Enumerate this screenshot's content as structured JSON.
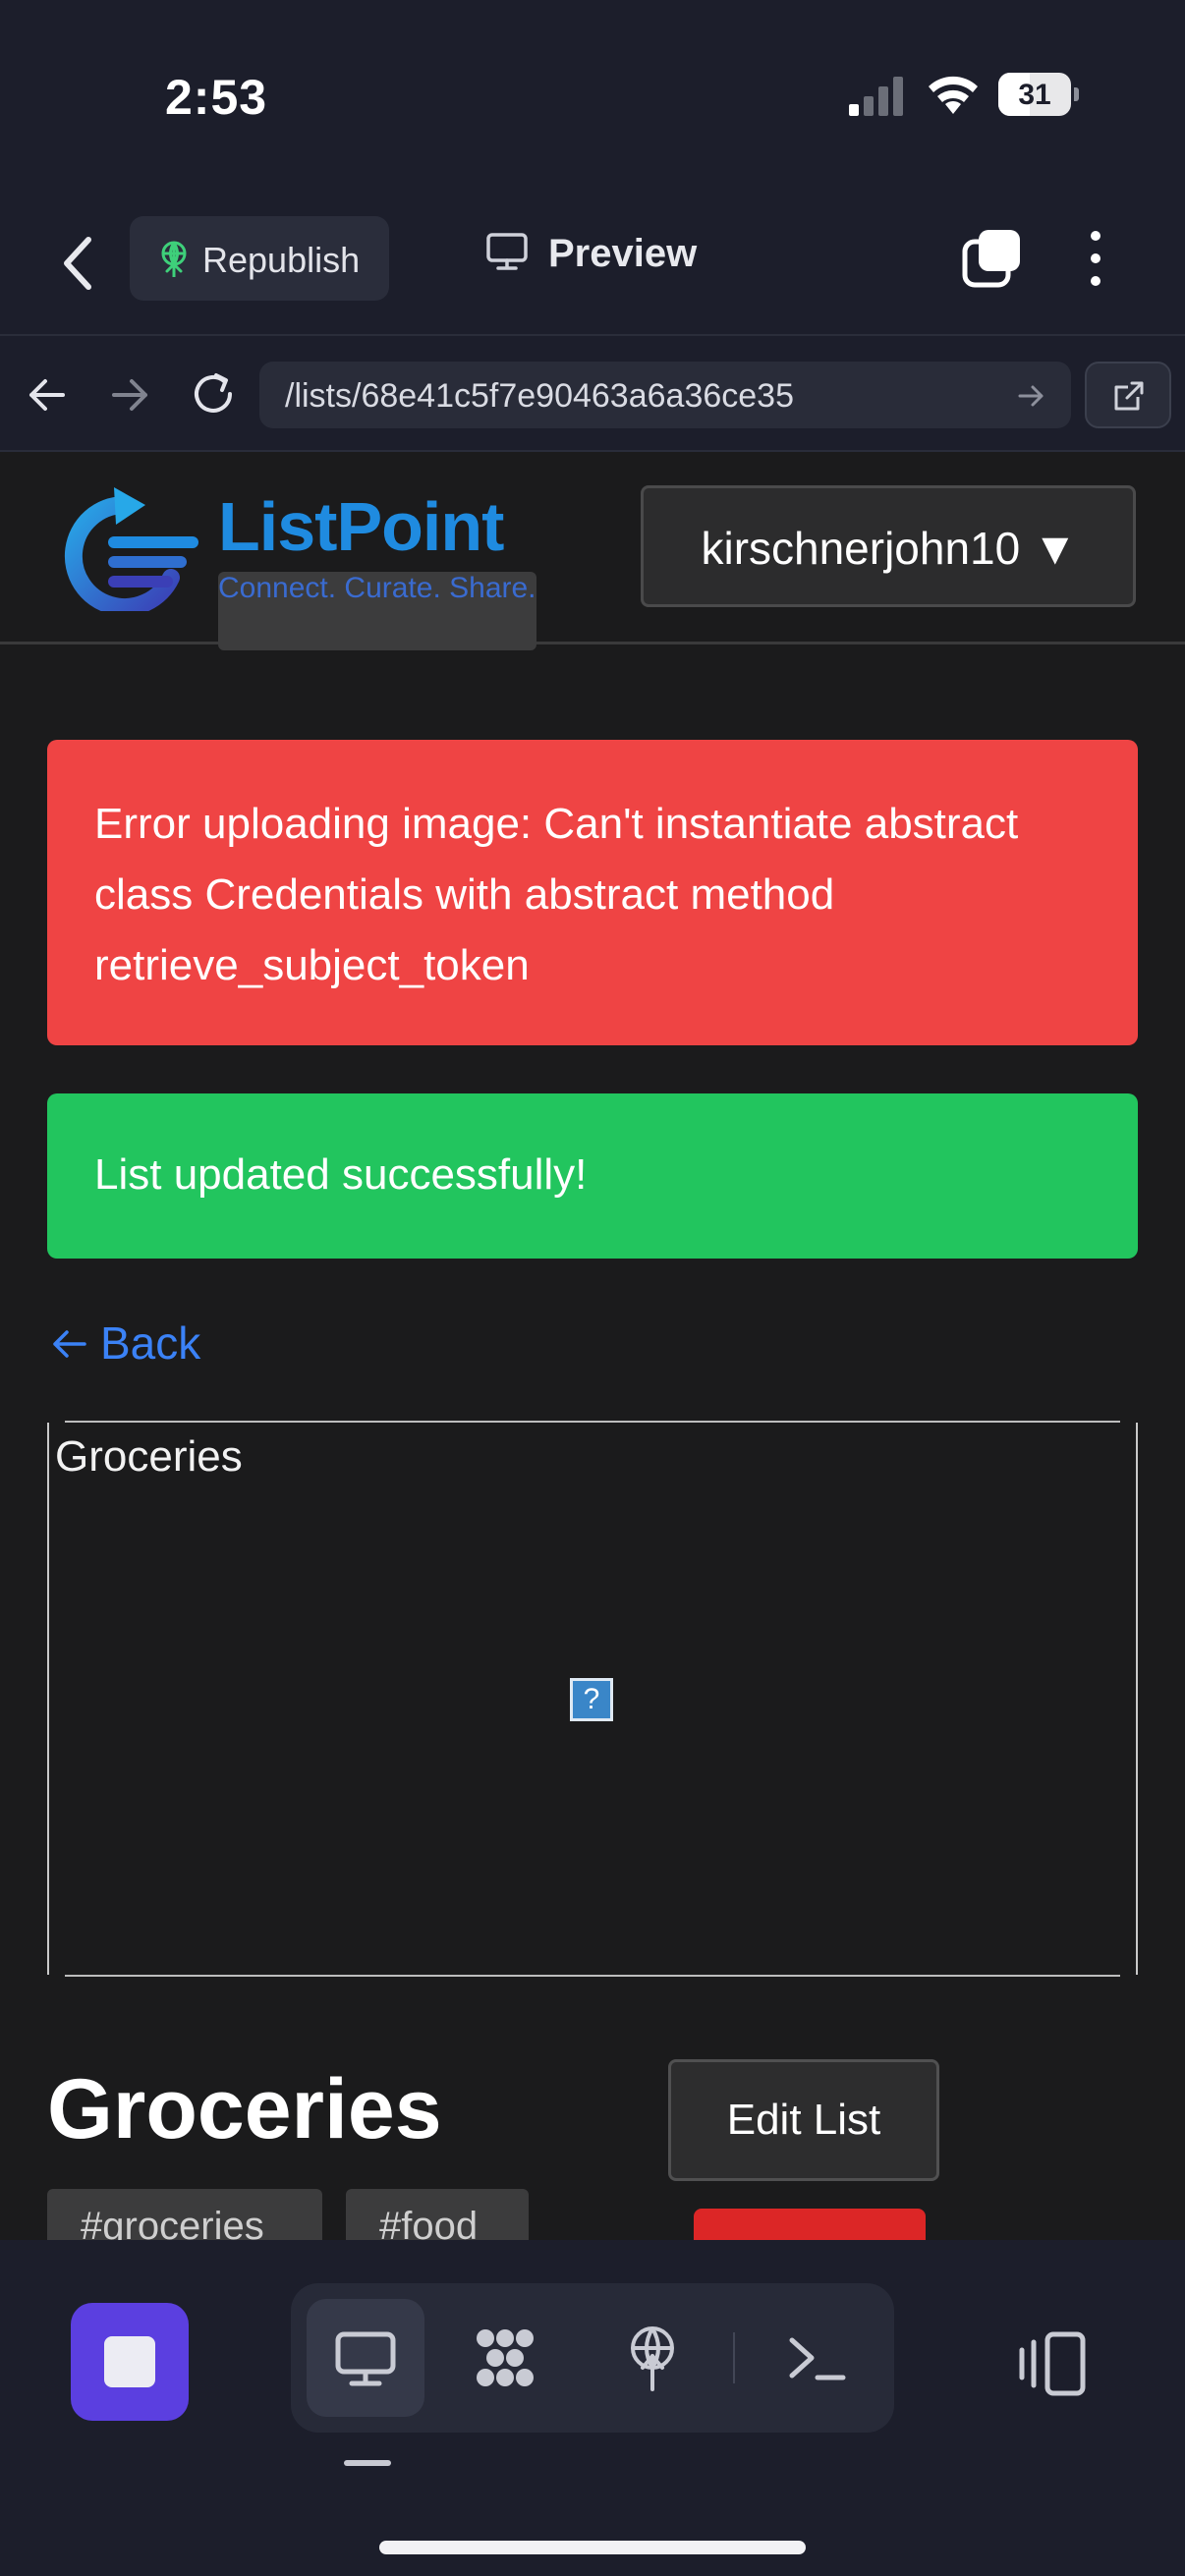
{
  "status_bar": {
    "time": "2:53",
    "battery": "31"
  },
  "topbar": {
    "republish_label": "Republish",
    "preview_label": "Preview"
  },
  "browser": {
    "url": "/lists/68e41c5f7e90463a6a36ce35"
  },
  "site": {
    "logo_word": "ListPoint",
    "logo_tagline": "Connect. Curate. Share.",
    "user_menu_label": "kirschnerjohn10 ▼"
  },
  "alerts": {
    "error": "Error uploading image: Can't instantiate abstract class Credentials with abstract method retrieve_subject_token",
    "success": "List updated successfully!"
  },
  "back_link": "Back",
  "image_alt": "Groceries",
  "list": {
    "title": "Groceries",
    "edit_label": "Edit List",
    "tags": [
      "#groceries",
      "#food"
    ]
  },
  "colors": {
    "error_bg": "#ef4444",
    "success_bg": "#22c55e",
    "link": "#3b82f6",
    "stop_button": "#5b3fe0",
    "danger_button": "#dc2626"
  },
  "icons": {
    "topbar": [
      "back-chevron-icon",
      "republish-icon",
      "monitor-icon",
      "tabs-icon",
      "more-vertical-icon"
    ],
    "browser": [
      "arrow-left-icon",
      "arrow-right-icon",
      "reload-icon",
      "go-arrow-icon",
      "external-link-icon"
    ],
    "toolbar": [
      "stop-icon",
      "monitor-icon",
      "modules-icon",
      "deploy-icon",
      "terminal-icon",
      "panels-icon"
    ]
  }
}
